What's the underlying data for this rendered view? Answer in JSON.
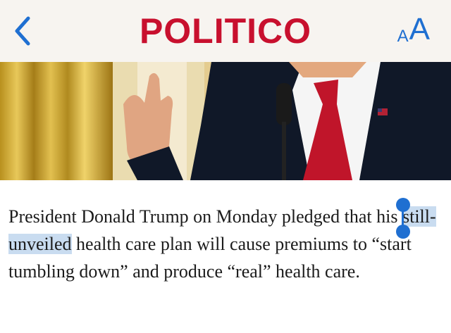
{
  "nav": {
    "back_icon": "chevron-left-icon",
    "logo_text": "POLITICO",
    "text_size_small": "A",
    "text_size_large": "A",
    "accent_color": "#1f6fd1",
    "logo_color": "#c8102e"
  },
  "hero": {
    "icon": "photo-trump-speaking"
  },
  "article": {
    "line1": "President Donald Trump on Monday pledged that his",
    "selected_text": "still-unveiled",
    "after_selected": " health care plan will cause premiums to “start tumbling down” and produce “real” health care."
  }
}
